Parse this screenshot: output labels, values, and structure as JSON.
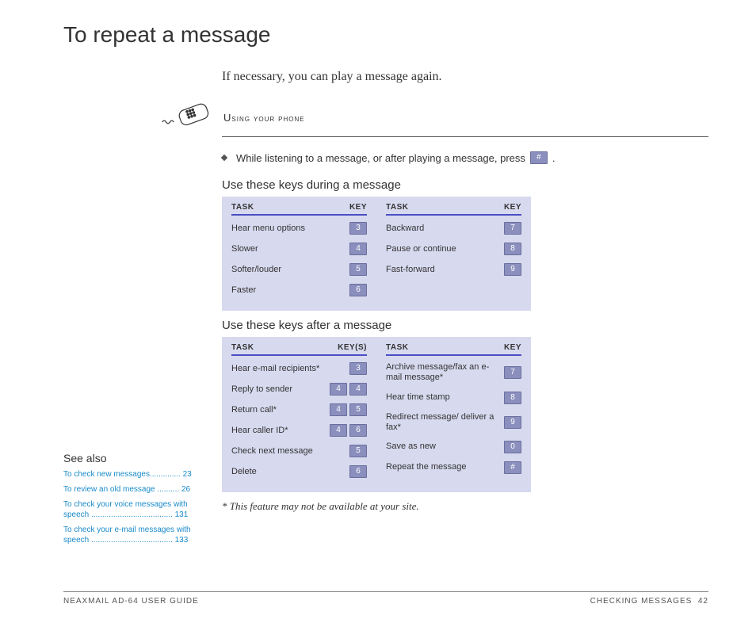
{
  "title": "To repeat a message",
  "intro": "If necessary, you can play a message again.",
  "phone_label": "Using your phone",
  "bullet_text_before": "While listening to a message, or after playing a message, press ",
  "bullet_key": "#",
  "bullet_text_after": ".",
  "during_heading": "Use these keys during a message",
  "after_heading": "Use these keys after a message",
  "col_task": "TASK",
  "col_key": "KEY",
  "col_keys": "KEY(S)",
  "during_left": [
    {
      "task": "Hear menu options",
      "keys": [
        "3"
      ]
    },
    {
      "task": "Slower",
      "keys": [
        "4"
      ]
    },
    {
      "task": "Softer/louder",
      "keys": [
        "5"
      ]
    },
    {
      "task": "Faster",
      "keys": [
        "6"
      ]
    }
  ],
  "during_right": [
    {
      "task": "Backward",
      "keys": [
        "7"
      ]
    },
    {
      "task": "Pause or continue",
      "keys": [
        "8"
      ]
    },
    {
      "task": "Fast-forward",
      "keys": [
        "9"
      ]
    }
  ],
  "after_left": [
    {
      "task": "Hear e-mail recipients*",
      "keys": [
        "3"
      ]
    },
    {
      "task": "Reply to sender",
      "keys": [
        "4",
        "4"
      ]
    },
    {
      "task": "Return call*",
      "keys": [
        "4",
        "5"
      ]
    },
    {
      "task": "Hear caller ID*",
      "keys": [
        "4",
        "6"
      ]
    },
    {
      "task": "Check next message",
      "keys": [
        "5"
      ]
    },
    {
      "task": "Delete",
      "keys": [
        "6"
      ]
    }
  ],
  "after_right": [
    {
      "task": "Archive message/fax an e-mail message*",
      "keys": [
        "7"
      ]
    },
    {
      "task": "Hear time stamp",
      "keys": [
        "8"
      ]
    },
    {
      "task": "Redirect message/ deliver a fax*",
      "keys": [
        "9"
      ]
    },
    {
      "task": "Save as new",
      "keys": [
        "0"
      ]
    },
    {
      "task": "Repeat the message",
      "keys": [
        "#"
      ]
    }
  ],
  "footnote": "* This feature may not be available at your site.",
  "see_also_title": "See also",
  "see_also": [
    {
      "label": "To check new messages..............",
      "page": "23"
    },
    {
      "label": "To review an old message ..........",
      "page": "26"
    },
    {
      "label": "To check your voice messages with speech .....................................",
      "page": "131"
    },
    {
      "label": "To check your e-mail messages with speech .....................................",
      "page": "133"
    }
  ],
  "footer_left": "NEAXMAIL AD-64 USER GUIDE",
  "footer_right_label": "CHECKING MESSAGES",
  "footer_page": "42"
}
